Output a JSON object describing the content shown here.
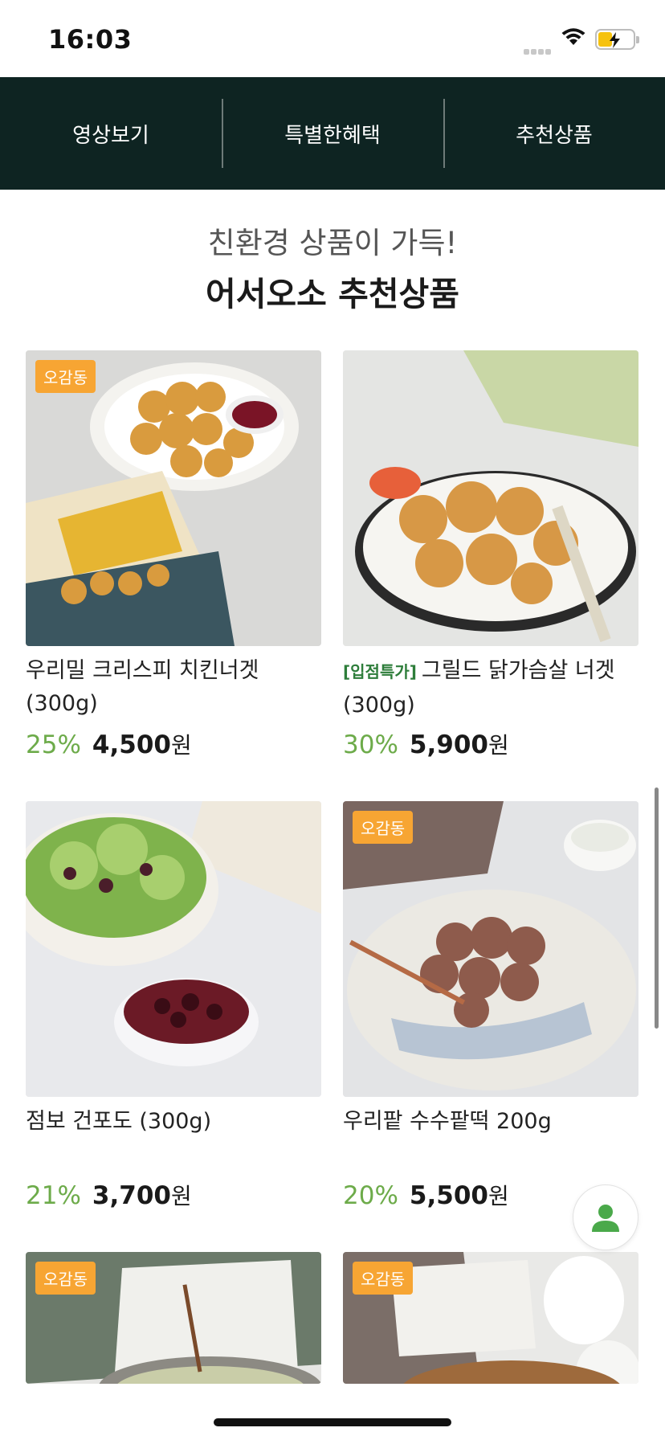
{
  "status_bar": {
    "time": "16:03"
  },
  "top_nav": {
    "tabs": [
      {
        "label": "영상보기"
      },
      {
        "label": "특별한혜택"
      },
      {
        "label": "추천상품"
      }
    ]
  },
  "section": {
    "subtitle": "친환경 상품이 가득!",
    "title": "어서오소 추천상품"
  },
  "products": [
    {
      "badge": "오감동",
      "promo": "",
      "name": "우리밀 크리스피 치킨너겟 (300g)",
      "discount": "25%",
      "price": "4,500",
      "currency": "원"
    },
    {
      "badge": "",
      "promo": "[입점특가]",
      "name": "그릴드 닭가슴살 너겟 (300g)",
      "discount": "30%",
      "price": "5,900",
      "currency": "원"
    },
    {
      "badge": "",
      "promo": "",
      "name": "점보 건포도 (300g)",
      "discount": "21%",
      "price": "3,700",
      "currency": "원"
    },
    {
      "badge": "오감동",
      "promo": "",
      "name": "우리팥 수수팥떡 200g",
      "discount": "20%",
      "price": "5,500",
      "currency": "원"
    },
    {
      "badge": "오감동"
    },
    {
      "badge": "오감동"
    }
  ],
  "colors": {
    "nav_bg": "#0e2422",
    "discount": "#6dab4a",
    "badge": "#f7a533",
    "promo": "#2d7d3a"
  },
  "icons": {
    "fab": "user-icon"
  }
}
